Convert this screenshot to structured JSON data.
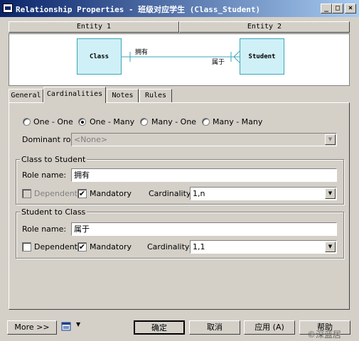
{
  "window": {
    "title": "Relationship Properties - 班级对应学生 (Class_Student)",
    "controls": {
      "minimize": "_",
      "maximize": "□",
      "close": "×"
    }
  },
  "entities": {
    "entity1_header": "Entity 1",
    "entity2_header": "Entity 2"
  },
  "diagram": {
    "left_entity": "Class",
    "right_entity": "Student",
    "left_role": "拥有",
    "right_role": "属于"
  },
  "tabs": [
    {
      "label": "General"
    },
    {
      "label": "Cardinalities",
      "active": true
    },
    {
      "label": "Notes"
    },
    {
      "label": "Rules"
    }
  ],
  "cardinality_options": [
    {
      "label": "One - One",
      "selected": false
    },
    {
      "label": "One - Many",
      "selected": true
    },
    {
      "label": "Many - One",
      "selected": false
    },
    {
      "label": "Many - Many",
      "selected": false
    }
  ],
  "dominant_role": {
    "label": "Dominant role:",
    "value": "<None>"
  },
  "class_to_student": {
    "group_label": "Class to Student",
    "role_name_label": "Role name:",
    "role_name": "拥有",
    "dependent_label": "Dependent",
    "dependent_checked": false,
    "mandatory_label": "Mandatory",
    "mandatory_checked": true,
    "cardinality_label": "Cardinality:",
    "cardinality": "1,n"
  },
  "student_to_class": {
    "group_label": "Student to Class",
    "role_name_label": "Role name:",
    "role_name": "属于",
    "dependent_label": "Dependent",
    "dependent_checked": false,
    "mandatory_label": "Mandatory",
    "mandatory_checked": true,
    "cardinality_label": "Cardinality:",
    "cardinality": "1,1"
  },
  "footer": {
    "more_label": "More >>",
    "ok_label": "确定",
    "cancel_label": "取消",
    "apply_label": "应用 (A)",
    "help_label": "帮助"
  },
  "watermark": "©深蓝居",
  "colors": {
    "title_start": "#0a246a",
    "title_end": "#a6caf0",
    "entity_fill": "#cff0f6",
    "entity_border": "#3aa6b8",
    "link": "#3aa6b8"
  }
}
